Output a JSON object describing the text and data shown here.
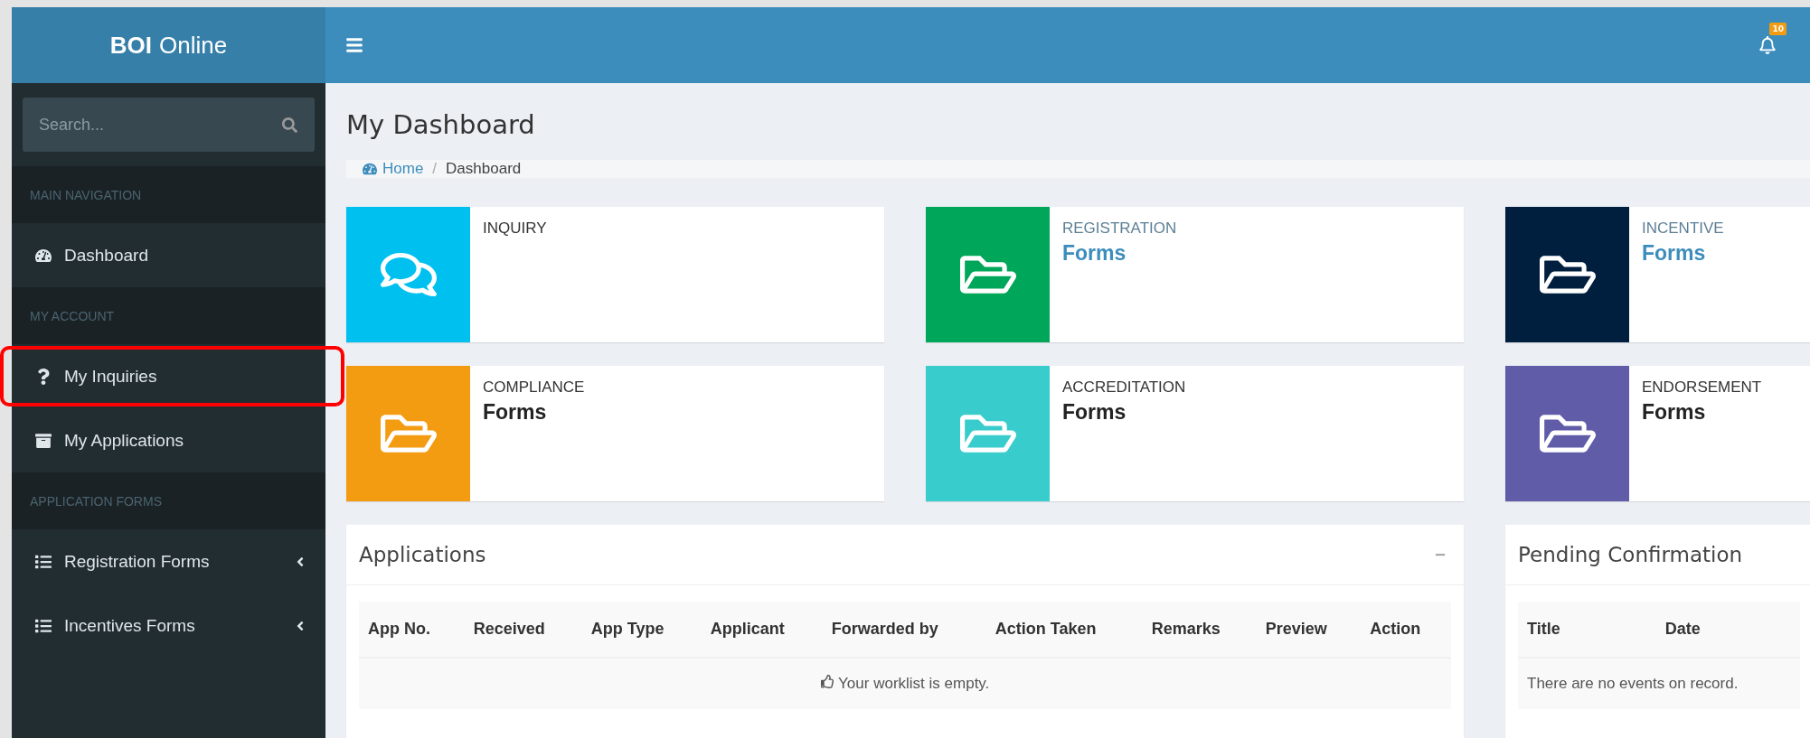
{
  "logo": {
    "bold": "BOI",
    "rest": "Online"
  },
  "topbar": {
    "notifications": "10"
  },
  "sidebar": {
    "search": {
      "placeholder": "Search..."
    },
    "items": [
      {
        "kind": "header",
        "label": "MAIN NAVIGATION"
      },
      {
        "kind": "link",
        "label": "Dashboard",
        "highlighted": false
      },
      {
        "kind": "header",
        "label": "MY ACCOUNT"
      },
      {
        "kind": "link",
        "label": "My Inquiries",
        "highlighted": true
      },
      {
        "kind": "link",
        "label": "My Applications",
        "highlighted": false
      },
      {
        "kind": "header",
        "label": "APPLICATION FORMS"
      },
      {
        "kind": "submenu",
        "label": "Registration Forms",
        "highlighted": false
      },
      {
        "kind": "submenu",
        "label": "Incentives Forms",
        "highlighted": false
      }
    ]
  },
  "page": {
    "title": "My Dashboard",
    "breadcrumb_separator": "/",
    "breadcrumb": [
      {
        "label": "Home",
        "link": true
      },
      {
        "label": "Dashboard",
        "link": false
      }
    ]
  },
  "info_boxes": [
    {
      "kind": "inquiry",
      "title": "INQUIRY",
      "color": "#00c0ef",
      "linked": false
    },
    {
      "kind": "folder",
      "title": "REGISTRATION",
      "subtitle": "Forms",
      "color": "#00a65a",
      "linked": true
    },
    {
      "kind": "folder",
      "title": "INCENTIVE",
      "subtitle": "Forms",
      "color": "#001f3f",
      "linked": true
    },
    {
      "kind": "folder",
      "title": "COMPLIANCE",
      "subtitle": "Forms",
      "color": "#f39c12",
      "linked": false
    },
    {
      "kind": "folder",
      "title": "ACCREDITATION",
      "subtitle": "Forms",
      "color": "#39cccc",
      "linked": false
    },
    {
      "kind": "folder",
      "title": "ENDORSEMENT",
      "subtitle": "Forms",
      "color": "#605ca8",
      "linked": false
    }
  ],
  "applications": {
    "title": "Applications",
    "columns": [
      "App No.",
      "Received",
      "App Type",
      "Applicant",
      "Forwarded by",
      "Action Taken",
      "Remarks",
      "Preview",
      "Action"
    ],
    "empty_message": "Your worklist is empty."
  },
  "pending": {
    "title": "Pending Confirmation",
    "columns": [
      "Title",
      "Date"
    ],
    "empty_message": "There are no events on record."
  }
}
